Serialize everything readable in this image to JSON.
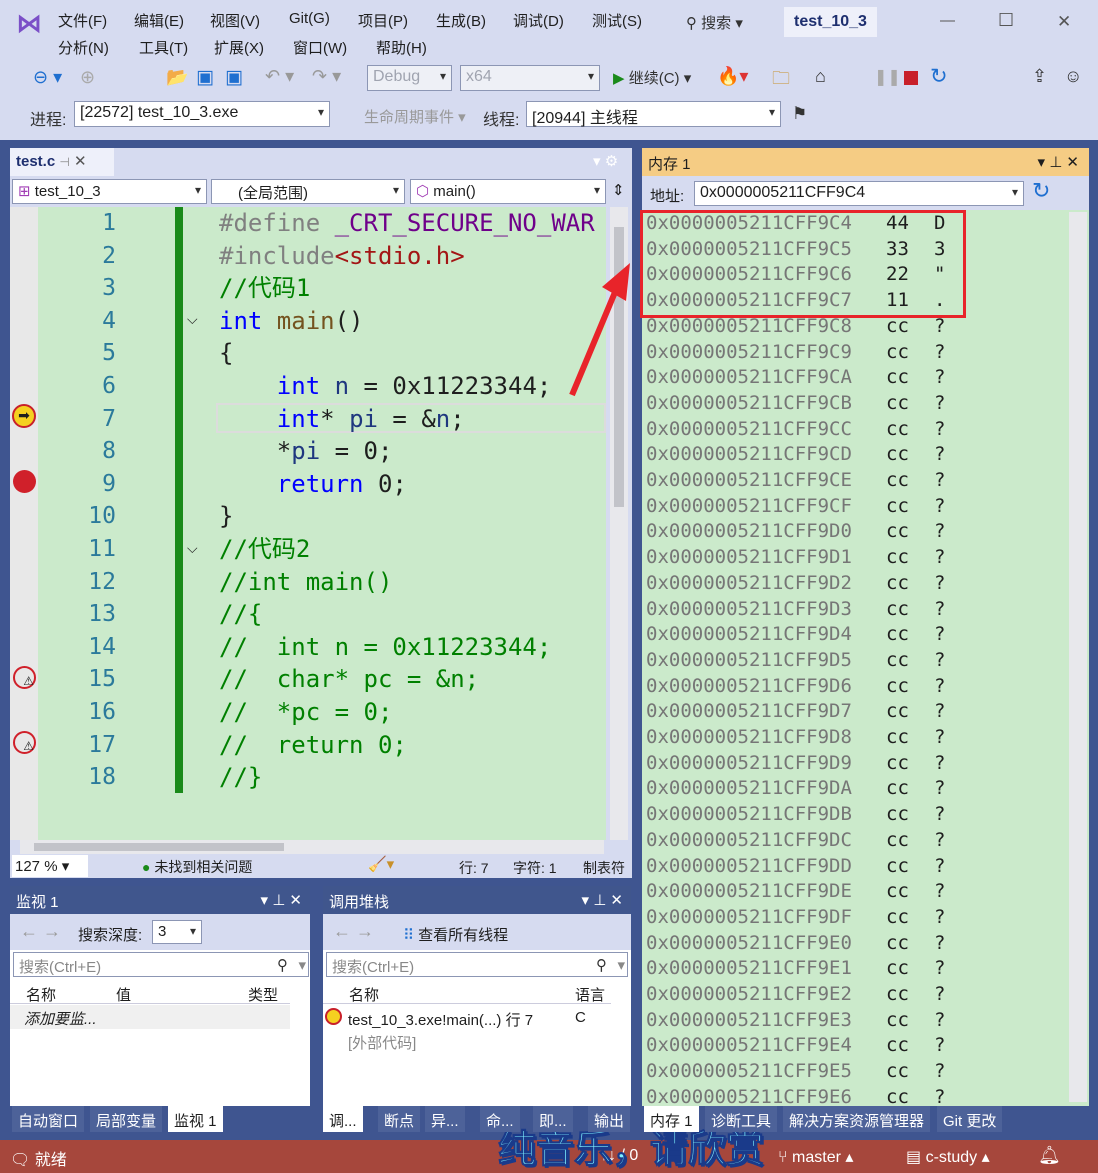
{
  "window": {
    "title": "test_10_3",
    "minimize": "—",
    "maximize": "☐",
    "close": "✕"
  },
  "menu": [
    "文件(F)",
    "编辑(E)",
    "视图(V)",
    "Git(G)",
    "项目(P)",
    "生成(B)",
    "调试(D)",
    "测试(S)",
    "分析(N)",
    "工具(T)",
    "扩展(X)",
    "窗口(W)",
    "帮助(H)"
  ],
  "search_label": "搜索",
  "toolbar": {
    "config": "Debug",
    "platform": "x64",
    "continue": "继续(C)"
  },
  "debugbar": {
    "process_label": "进程:",
    "process": "[22572] test_10_3.exe",
    "lifecycle": "生命周期事件",
    "thread_label": "线程:",
    "thread": "[20944] 主线程"
  },
  "editor": {
    "tab": "test.c",
    "project": "test_10_3",
    "scope": "(全局范围)",
    "member": "main()",
    "zoom": "127 %",
    "issues": "未找到相关问题",
    "line": "行: 7",
    "char": "字符: 1",
    "tabs": "制表符",
    "lines": [
      [
        [
          "pp",
          "#define "
        ],
        [
          "mac",
          "_CRT_SECURE_NO_WAR"
        ]
      ],
      [
        [
          "pp",
          "#include"
        ],
        [
          "str",
          "<stdio.h>"
        ]
      ],
      [
        [
          "cm",
          "//代码1"
        ]
      ],
      [
        [
          "kw",
          "int "
        ],
        [
          "fn",
          "main"
        ],
        [
          "",
          "()"
        ]
      ],
      [
        [
          "",
          "{"
        ]
      ],
      [
        [
          "",
          "    "
        ],
        [
          "kw",
          "int "
        ],
        [
          "var",
          "n"
        ],
        [
          "",
          " = 0x11223344;"
        ]
      ],
      [
        [
          "",
          "    "
        ],
        [
          "kw",
          "int"
        ],
        [
          "",
          "* "
        ],
        [
          "var",
          "pi"
        ],
        [
          "",
          " = &"
        ],
        [
          "var",
          "n"
        ],
        [
          "",
          ";"
        ]
      ],
      [
        [
          "",
          "    *"
        ],
        [
          "var",
          "pi"
        ],
        [
          "",
          " = 0;"
        ]
      ],
      [
        [
          "",
          "    "
        ],
        [
          "kw",
          "return "
        ],
        [
          "",
          "0;"
        ]
      ],
      [
        [
          "",
          "}"
        ]
      ],
      [
        [
          "cm",
          "//代码2"
        ]
      ],
      [
        [
          "cm",
          "//int main()"
        ]
      ],
      [
        [
          "cm",
          "//{"
        ]
      ],
      [
        [
          "cm",
          "//  int n = 0x11223344;"
        ]
      ],
      [
        [
          "cm",
          "//  char* pc = &n;"
        ]
      ],
      [
        [
          "cm",
          "//  *pc = 0;"
        ]
      ],
      [
        [
          "cm",
          "//  return 0;"
        ]
      ],
      [
        [
          "cm",
          "//}"
        ]
      ]
    ]
  },
  "memory": {
    "title": "内存 1",
    "address_label": "地址:",
    "address": "0x0000005211CFF9C4",
    "rows": [
      [
        "0x0000005211CFF9C4",
        "44",
        "D"
      ],
      [
        "0x0000005211CFF9C5",
        "33",
        "3"
      ],
      [
        "0x0000005211CFF9C6",
        "22",
        "\""
      ],
      [
        "0x0000005211CFF9C7",
        "11",
        "."
      ],
      [
        "0x0000005211CFF9C8",
        "cc",
        "?"
      ],
      [
        "0x0000005211CFF9C9",
        "cc",
        "?"
      ],
      [
        "0x0000005211CFF9CA",
        "cc",
        "?"
      ],
      [
        "0x0000005211CFF9CB",
        "cc",
        "?"
      ],
      [
        "0x0000005211CFF9CC",
        "cc",
        "?"
      ],
      [
        "0x0000005211CFF9CD",
        "cc",
        "?"
      ],
      [
        "0x0000005211CFF9CE",
        "cc",
        "?"
      ],
      [
        "0x0000005211CFF9CF",
        "cc",
        "?"
      ],
      [
        "0x0000005211CFF9D0",
        "cc",
        "?"
      ],
      [
        "0x0000005211CFF9D1",
        "cc",
        "?"
      ],
      [
        "0x0000005211CFF9D2",
        "cc",
        "?"
      ],
      [
        "0x0000005211CFF9D3",
        "cc",
        "?"
      ],
      [
        "0x0000005211CFF9D4",
        "cc",
        "?"
      ],
      [
        "0x0000005211CFF9D5",
        "cc",
        "?"
      ],
      [
        "0x0000005211CFF9D6",
        "cc",
        "?"
      ],
      [
        "0x0000005211CFF9D7",
        "cc",
        "?"
      ],
      [
        "0x0000005211CFF9D8",
        "cc",
        "?"
      ],
      [
        "0x0000005211CFF9D9",
        "cc",
        "?"
      ],
      [
        "0x0000005211CFF9DA",
        "cc",
        "?"
      ],
      [
        "0x0000005211CFF9DB",
        "cc",
        "?"
      ],
      [
        "0x0000005211CFF9DC",
        "cc",
        "?"
      ],
      [
        "0x0000005211CFF9DD",
        "cc",
        "?"
      ],
      [
        "0x0000005211CFF9DE",
        "cc",
        "?"
      ],
      [
        "0x0000005211CFF9DF",
        "cc",
        "?"
      ],
      [
        "0x0000005211CFF9E0",
        "cc",
        "?"
      ],
      [
        "0x0000005211CFF9E1",
        "cc",
        "?"
      ],
      [
        "0x0000005211CFF9E2",
        "cc",
        "?"
      ],
      [
        "0x0000005211CFF9E3",
        "cc",
        "?"
      ],
      [
        "0x0000005211CFF9E4",
        "cc",
        "?"
      ],
      [
        "0x0000005211CFF9E5",
        "cc",
        "?"
      ],
      [
        "0x0000005211CFF9E6",
        "cc",
        "?"
      ]
    ]
  },
  "watch": {
    "title": "监视 1",
    "depth_label": "搜索深度:",
    "depth": "3",
    "search_placeholder": "搜索(Ctrl+E)",
    "cols": [
      "名称",
      "值",
      "类型"
    ],
    "add": "添加要监..."
  },
  "callstack": {
    "title": "调用堆栈",
    "all_threads": "查看所有线程",
    "search_placeholder": "搜索(Ctrl+E)",
    "cols": [
      "名称",
      "语言"
    ],
    "rows": [
      [
        "test_10_3.exe!main(...) 行 7",
        "C"
      ],
      [
        "[外部代码]",
        ""
      ]
    ]
  },
  "bottom_tabs_left": [
    "自动窗口",
    "局部变量",
    "监视 1"
  ],
  "bottom_tabs_mid": [
    "调...",
    "断点",
    "异...",
    "命...",
    "即...",
    "输出"
  ],
  "bottom_tabs_right": [
    "内存 1",
    "诊断工具",
    "解决方案资源管理器",
    "Git 更改"
  ],
  "status": {
    "ready": "就绪",
    "changes": "↑↓ / 0",
    "branch": "master",
    "repo": "c-study"
  },
  "overlay": "纯音乐，请欣赏"
}
